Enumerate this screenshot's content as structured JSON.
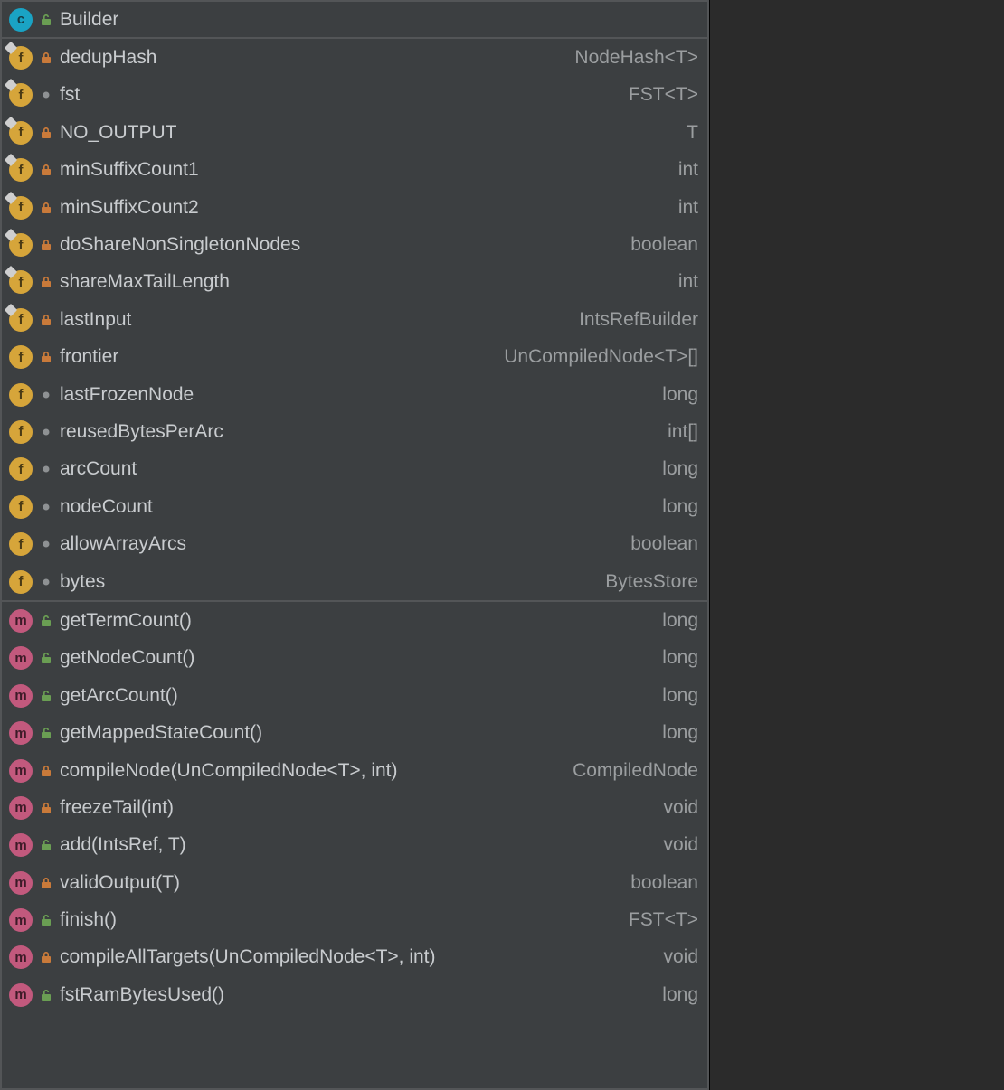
{
  "header": {
    "kind": "class",
    "visibility": "public",
    "name": "Builder"
  },
  "fields": [
    {
      "kind": "field",
      "pin": true,
      "visibility": "private",
      "name": "dedupHash",
      "type": "NodeHash<T>"
    },
    {
      "kind": "field",
      "pin": true,
      "visibility": "package",
      "name": "fst",
      "type": "FST<T>"
    },
    {
      "kind": "field",
      "pin": true,
      "visibility": "private",
      "name": "NO_OUTPUT",
      "type": "T"
    },
    {
      "kind": "field",
      "pin": true,
      "visibility": "private",
      "name": "minSuffixCount1",
      "type": "int"
    },
    {
      "kind": "field",
      "pin": true,
      "visibility": "private",
      "name": "minSuffixCount2",
      "type": "int"
    },
    {
      "kind": "field",
      "pin": true,
      "visibility": "private",
      "name": "doShareNonSingletonNodes",
      "type": "boolean"
    },
    {
      "kind": "field",
      "pin": true,
      "visibility": "private",
      "name": "shareMaxTailLength",
      "type": "int"
    },
    {
      "kind": "field",
      "pin": true,
      "visibility": "private",
      "name": "lastInput",
      "type": "IntsRefBuilder"
    },
    {
      "kind": "field",
      "pin": false,
      "visibility": "private",
      "name": "frontier",
      "type": "UnCompiledNode<T>[]"
    },
    {
      "kind": "field",
      "pin": false,
      "visibility": "package",
      "name": "lastFrozenNode",
      "type": "long"
    },
    {
      "kind": "field",
      "pin": false,
      "visibility": "package",
      "name": "reusedBytesPerArc",
      "type": "int[]"
    },
    {
      "kind": "field",
      "pin": false,
      "visibility": "package",
      "name": "arcCount",
      "type": "long"
    },
    {
      "kind": "field",
      "pin": false,
      "visibility": "package",
      "name": "nodeCount",
      "type": "long"
    },
    {
      "kind": "field",
      "pin": false,
      "visibility": "package",
      "name": "allowArrayArcs",
      "type": "boolean"
    },
    {
      "kind": "field",
      "pin": false,
      "visibility": "package",
      "name": "bytes",
      "type": "BytesStore"
    }
  ],
  "methods": [
    {
      "kind": "method",
      "visibility": "public",
      "name": "getTermCount()",
      "type": "long"
    },
    {
      "kind": "method",
      "visibility": "public",
      "name": "getNodeCount()",
      "type": "long"
    },
    {
      "kind": "method",
      "visibility": "public",
      "name": "getArcCount()",
      "type": "long"
    },
    {
      "kind": "method",
      "visibility": "public",
      "name": "getMappedStateCount()",
      "type": "long"
    },
    {
      "kind": "method",
      "visibility": "private",
      "name": "compileNode(UnCompiledNode<T>, int)",
      "type": "CompiledNode"
    },
    {
      "kind": "method",
      "visibility": "private",
      "name": "freezeTail(int)",
      "type": "void"
    },
    {
      "kind": "method",
      "visibility": "public",
      "name": "add(IntsRef, T)",
      "type": "void"
    },
    {
      "kind": "method",
      "visibility": "private",
      "name": "validOutput(T)",
      "type": "boolean"
    },
    {
      "kind": "method",
      "visibility": "public",
      "name": "finish()",
      "type": "FST<T>"
    },
    {
      "kind": "method",
      "visibility": "private",
      "name": "compileAllTargets(UnCompiledNode<T>, int)",
      "type": "void"
    },
    {
      "kind": "method",
      "visibility": "public",
      "name": "fstRamBytesUsed()",
      "type": "long"
    }
  ]
}
